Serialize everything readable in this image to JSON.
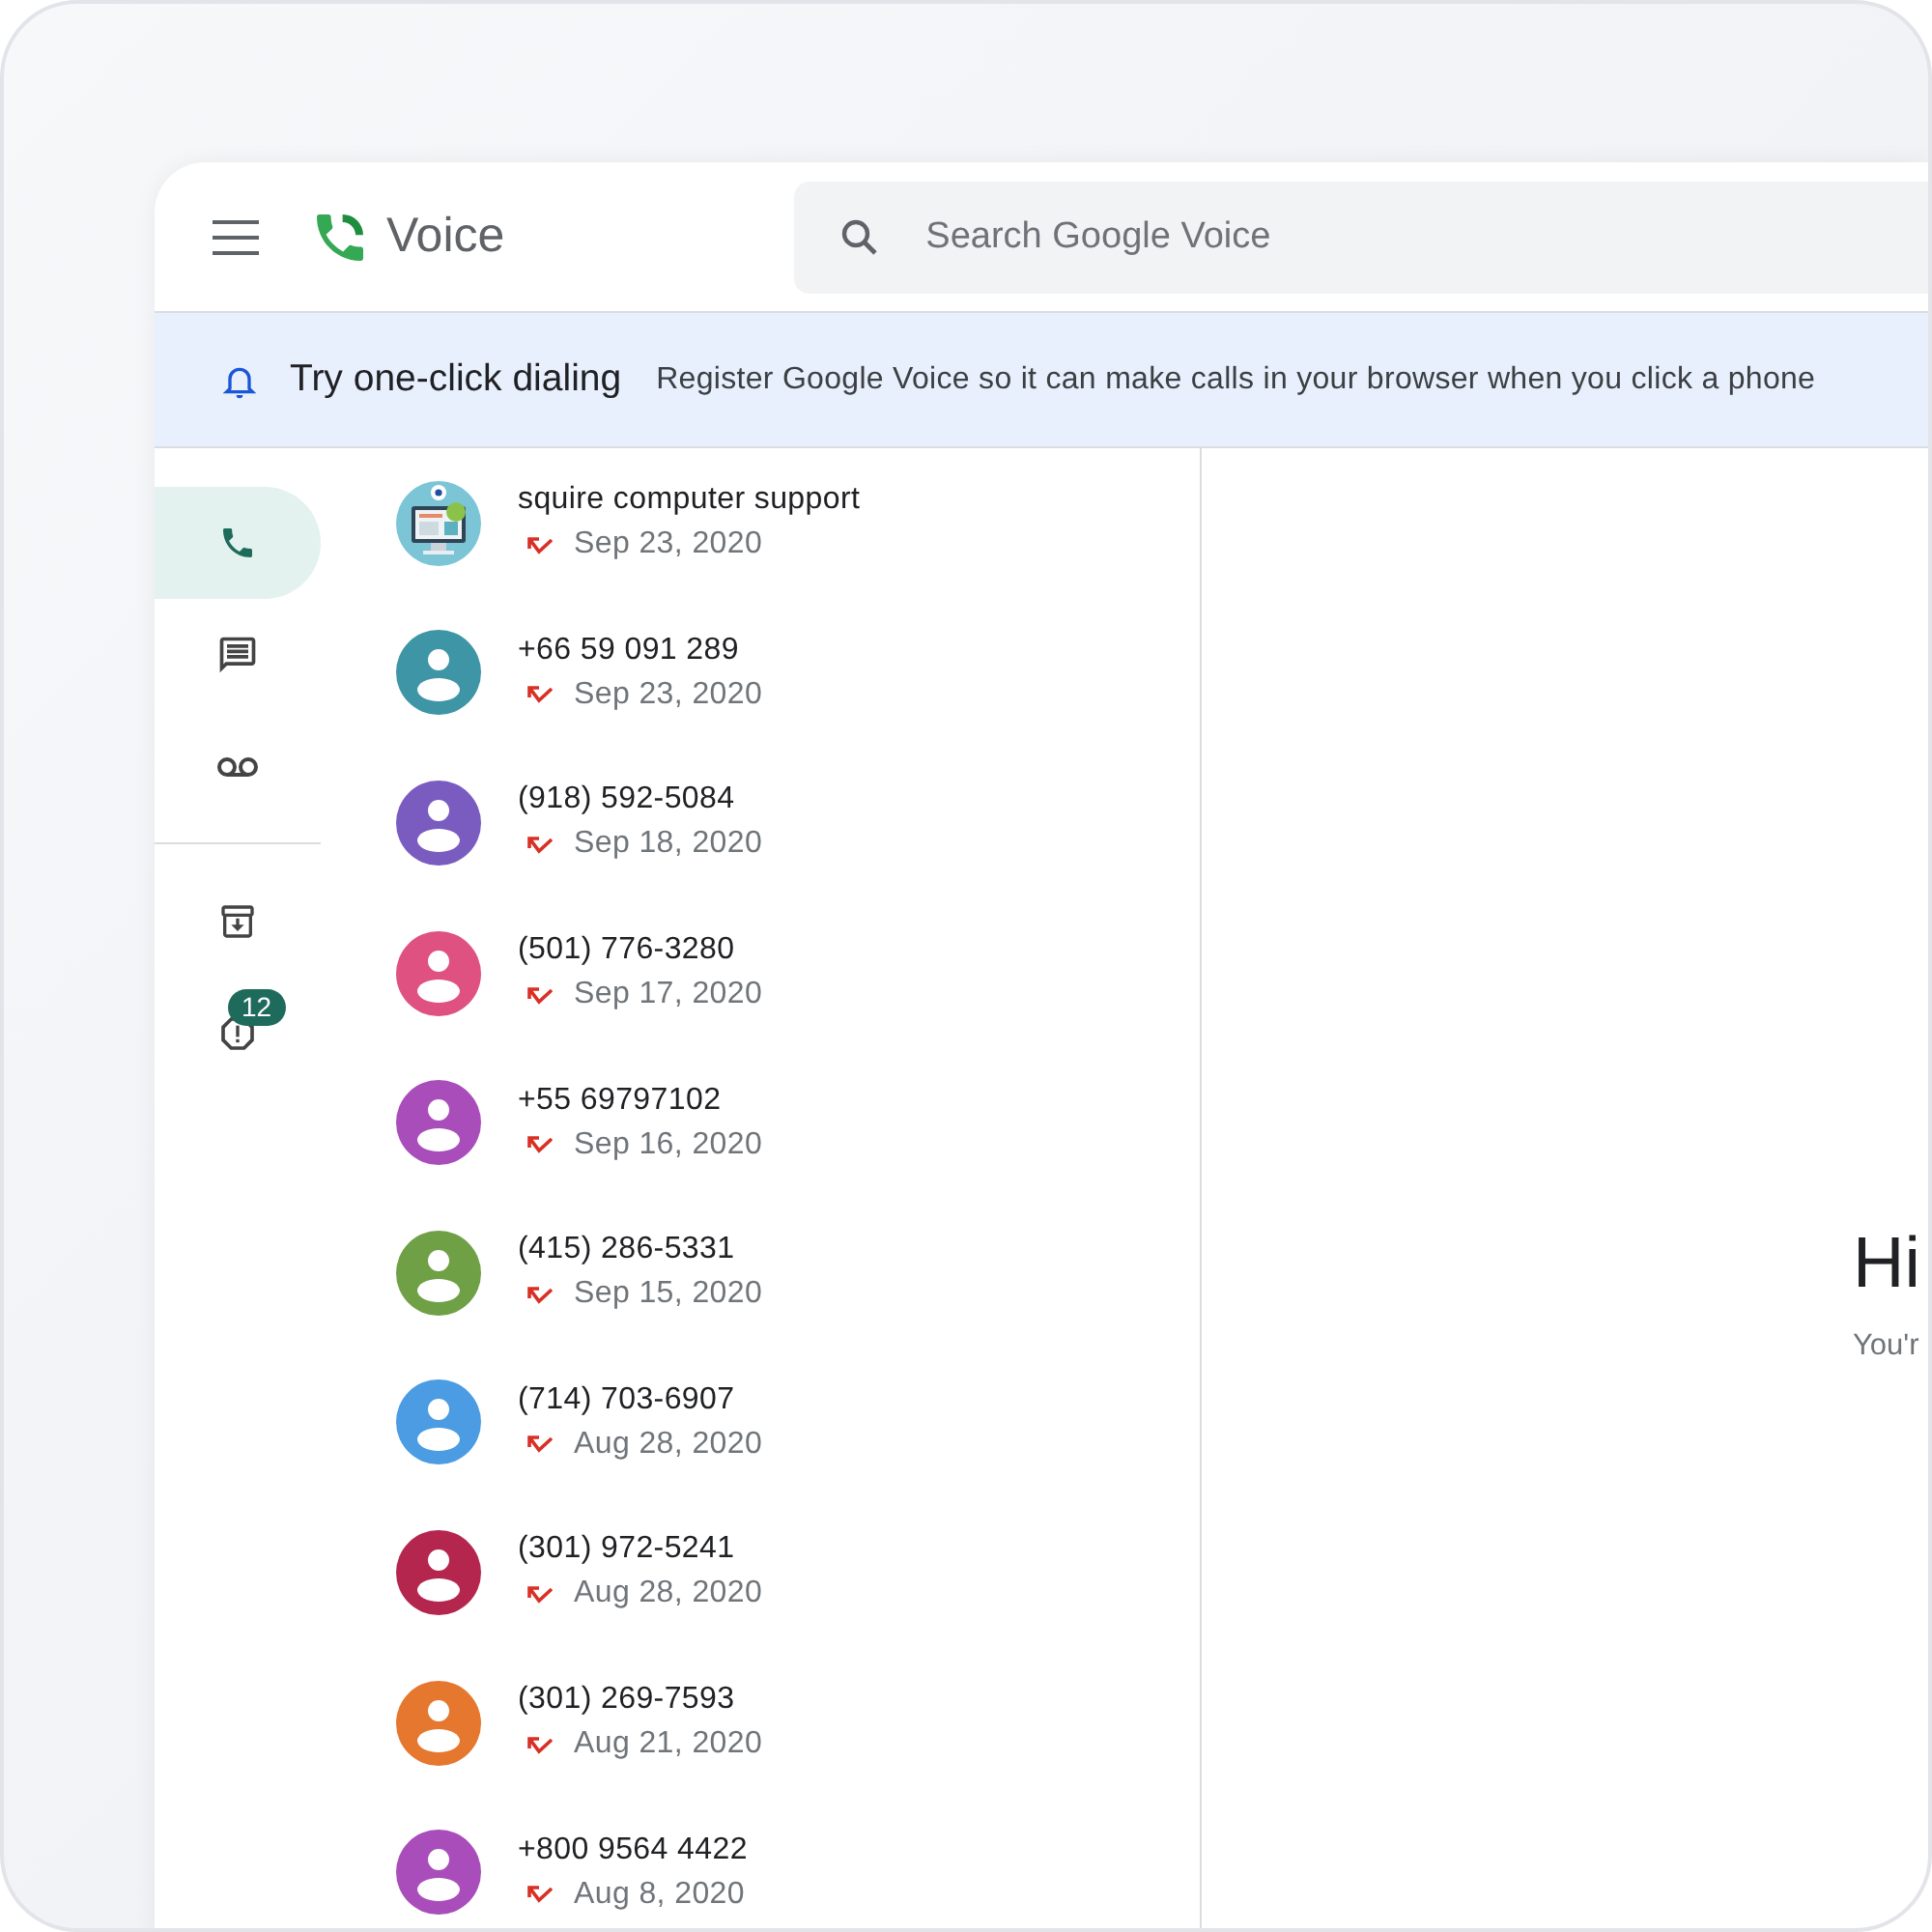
{
  "header": {
    "app_name": "Voice",
    "search": {
      "placeholder": "Search Google Voice"
    }
  },
  "banner": {
    "title": "Try one-click dialing",
    "message": "Register Google Voice so it can make calls in your browser when you click a phone"
  },
  "nav": [
    {
      "kind": "calls",
      "selected": true
    },
    {
      "kind": "messages",
      "selected": false
    },
    {
      "kind": "voicemail",
      "selected": false
    },
    {
      "kind": "divider"
    },
    {
      "kind": "archive",
      "selected": false
    },
    {
      "kind": "spam",
      "selected": false,
      "badge": "12"
    }
  ],
  "calls": [
    {
      "name": "squire computer support",
      "date": "Sep 23, 2020",
      "missed": true
    },
    {
      "name": "+66 59 091 289",
      "date": "Sep 23, 2020",
      "missed": true,
      "avatar": {
        "kind": "person",
        "color": "#3e95a5"
      }
    },
    {
      "name": "(918) 592-5084",
      "date": "Sep 18, 2020",
      "missed": true,
      "avatar": {
        "kind": "person",
        "color": "#7a5cc0"
      }
    },
    {
      "name": "(501) 776-3280",
      "date": "Sep 17, 2020",
      "missed": true,
      "avatar": {
        "kind": "person",
        "color": "#df5180"
      }
    },
    {
      "name": "+55 69797102",
      "date": "Sep 16, 2020",
      "missed": true,
      "avatar": {
        "kind": "person",
        "color": "#a94dbb"
      }
    },
    {
      "name": "(415) 286-5331",
      "date": "Sep 15, 2020",
      "missed": true,
      "avatar": {
        "kind": "person",
        "color": "#6fa046"
      }
    },
    {
      "name": "(714) 703-6907",
      "date": "Aug 28, 2020",
      "missed": true,
      "avatar": {
        "kind": "person",
        "color": "#4b9ce2"
      }
    },
    {
      "name": "(301) 972-5241",
      "date": "Aug 28, 2020",
      "missed": true,
      "avatar": {
        "kind": "person",
        "color": "#b5264f"
      }
    },
    {
      "name": "(301) 269-7593",
      "date": "Aug 21, 2020",
      "missed": true,
      "avatar": {
        "kind": "person",
        "color": "#e5772f"
      }
    },
    {
      "name": "+800 9564 4422",
      "date": "Aug 8, 2020",
      "missed": true,
      "avatar": {
        "kind": "person",
        "color": "#a94dbb"
      }
    }
  ],
  "pane": {
    "greeting": "Hi",
    "subtitle": "You'r"
  }
}
